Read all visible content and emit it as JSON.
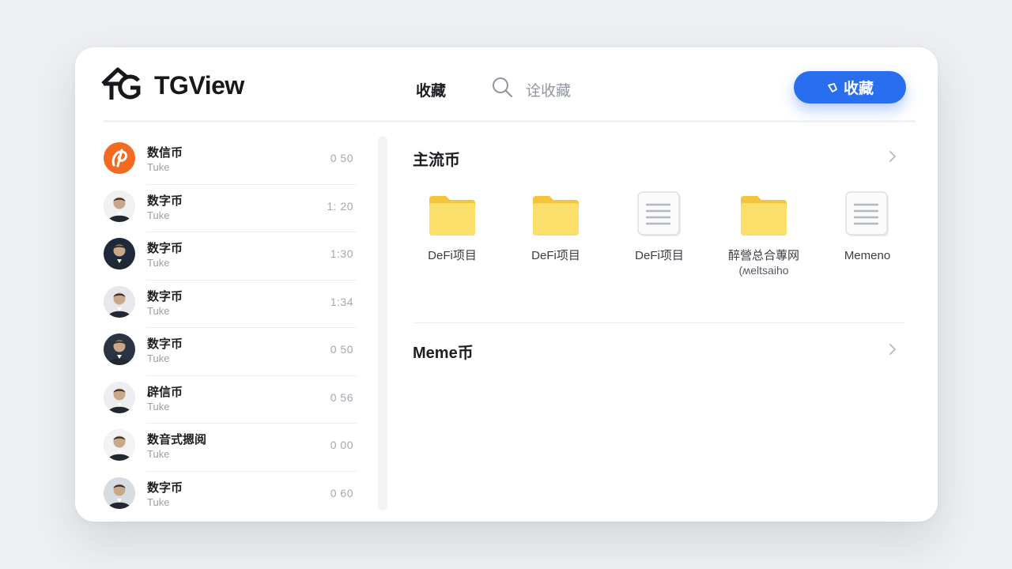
{
  "header": {
    "app_title": "TGView",
    "nav_label": "收藏",
    "search_placeholder": "诠收藏",
    "cta_label": "收藏"
  },
  "contacts": [
    {
      "title": "数信币",
      "subtitle": "Tuke",
      "time": "0 50",
      "avatar": "brand-logo"
    },
    {
      "title": "数字币",
      "subtitle": "Tuke",
      "time": "1: 20",
      "avatar": "person"
    },
    {
      "title": "数字币",
      "subtitle": "Tuke",
      "time": "1:30",
      "avatar": "person"
    },
    {
      "title": "数字币",
      "subtitle": "Tuke",
      "time": "1:34",
      "avatar": "person"
    },
    {
      "title": "数字币",
      "subtitle": "Tuke",
      "time": "0 50",
      "avatar": "person"
    },
    {
      "title": "辟信币",
      "subtitle": "Tuke",
      "time": "0 56",
      "avatar": "person"
    },
    {
      "title": "数音式摁阅",
      "subtitle": "Tuke",
      "time": "0 00",
      "avatar": "person"
    },
    {
      "title": "数字币",
      "subtitle": "Tuke",
      "time": "0 60",
      "avatar": "person"
    }
  ],
  "sections": [
    {
      "title": "主流币",
      "items": [
        {
          "label": "DeFi项目",
          "sublabel": "",
          "icon": "folder-icon"
        },
        {
          "label": "DeFi项目",
          "sublabel": "",
          "icon": "folder-icon"
        },
        {
          "label": "DeFi项目",
          "sublabel": "",
          "icon": "document-icon"
        },
        {
          "label": "醉營总合蓴网",
          "sublabel": "(ʍeltsaiho",
          "icon": "folder-icon"
        },
        {
          "label": "Memeno",
          "sublabel": "",
          "icon": "document-icon"
        }
      ]
    },
    {
      "title": "Meme币",
      "items": []
    }
  ],
  "colors": {
    "accent": "#2a6ef0",
    "folder": "#f8d34e",
    "background": "#eef0f3"
  }
}
